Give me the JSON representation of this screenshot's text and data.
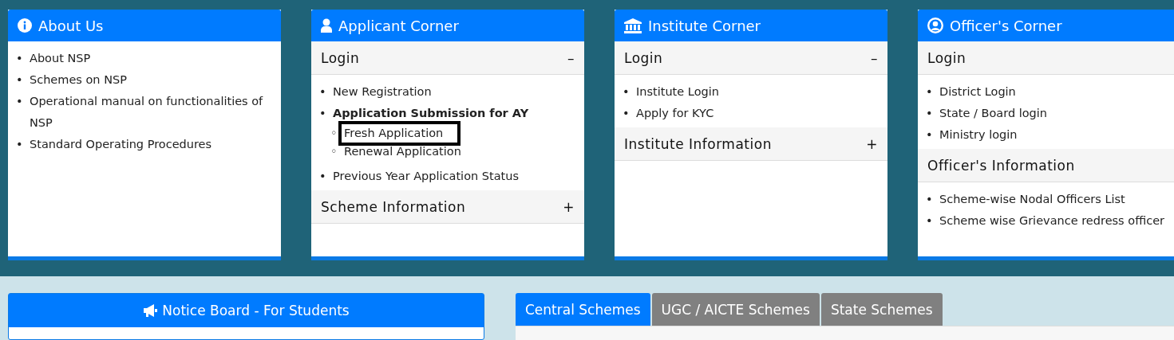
{
  "cards": [
    {
      "title": "About Us",
      "items": [
        {
          "marker": "•",
          "text": "About NSP"
        },
        {
          "marker": "•",
          "text": "Schemes on NSP"
        },
        {
          "marker": "•",
          "text": "Operational manual on functionalities of NSP"
        },
        {
          "marker": "•",
          "text": "Standard Operating Procedures"
        }
      ]
    },
    {
      "title": "Applicant Corner",
      "sections": [
        {
          "title": "Login",
          "toggle": "–",
          "items": [
            {
              "marker": "•",
              "text": "New Registration",
              "bold": false
            },
            {
              "marker": "•",
              "text": "Application Submission for AY",
              "bold": true,
              "children": [
                {
                  "marker": "◦",
                  "text": "Fresh Application",
                  "highlighted": true
                },
                {
                  "marker": "◦",
                  "text": "Renewal Application",
                  "highlighted": false
                }
              ]
            },
            {
              "marker": "•",
              "text": "Previous Year Application Status",
              "bold": false
            }
          ]
        },
        {
          "title": "Scheme Information",
          "toggle": "+"
        }
      ]
    },
    {
      "title": "Institute Corner",
      "sections": [
        {
          "title": "Login",
          "toggle": "–",
          "items": [
            {
              "marker": "•",
              "text": "Institute Login"
            },
            {
              "marker": "•",
              "text": "Apply for KYC"
            }
          ]
        },
        {
          "title": "Institute Information",
          "toggle": "+"
        }
      ]
    },
    {
      "title": "Officer's Corner",
      "sections": [
        {
          "title": "Login",
          "items": [
            {
              "marker": "•",
              "text": "District Login"
            },
            {
              "marker": "•",
              "text": "State / Board login"
            },
            {
              "marker": "•",
              "text": "Ministry login"
            }
          ]
        },
        {
          "title": "Officer's Information",
          "items": [
            {
              "marker": "•",
              "text": "Scheme-wise Nodal Officers List"
            },
            {
              "marker": "•",
              "text": "Scheme wise Grievance redress officer"
            }
          ]
        }
      ]
    }
  ],
  "notice_board": {
    "title": "Notice Board - For Students"
  },
  "scheme_tabs": [
    {
      "label": "Central Schemes",
      "selected": true
    },
    {
      "label": "UGC / AICTE Schemes",
      "selected": false
    },
    {
      "label": "State Schemes",
      "selected": false
    }
  ]
}
